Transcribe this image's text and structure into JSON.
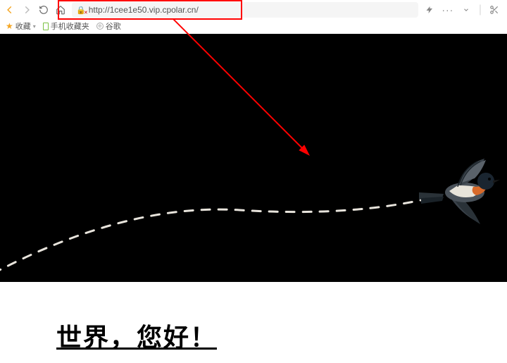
{
  "url": "http://1cee1e50.vip.cpolar.cn/",
  "bookmarks": {
    "fav_label": "收藏",
    "mobile_label": "手机收藏夹",
    "google_label": "谷歌"
  },
  "page": {
    "heading": "世界，您好！"
  },
  "icons": {
    "back": "back-icon",
    "forward": "forward-icon",
    "reload": "reload-icon",
    "home": "home-icon",
    "lock": "insecure-icon",
    "bolt": "bolt-icon",
    "more": "more-icon",
    "down": "chevron-down-icon",
    "scissors": "scissors-icon",
    "star": "star-icon",
    "phone": "phone-icon",
    "globe": "globe-icon"
  }
}
